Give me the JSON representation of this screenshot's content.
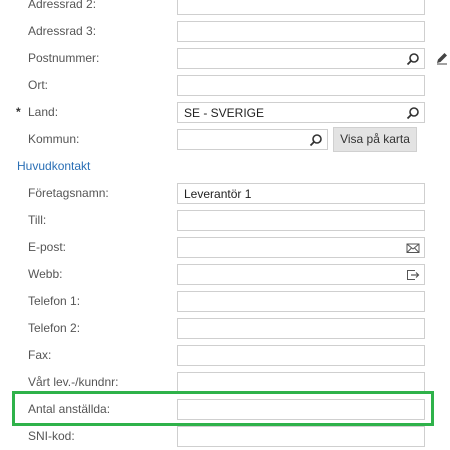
{
  "form": {
    "adressrad2": {
      "label": "Adressrad 2:",
      "value": ""
    },
    "adressrad3": {
      "label": "Adressrad 3:",
      "value": ""
    },
    "postnummer": {
      "label": "Postnummer:",
      "value": "",
      "icon": "search-icon"
    },
    "ort": {
      "label": "Ort:",
      "value": ""
    },
    "land": {
      "required_mark": "*",
      "label": "Land:",
      "value": "SE - SVERIGE",
      "icon": "search-icon"
    },
    "kommun": {
      "label": "Kommun:",
      "value": "",
      "icon": "search-icon",
      "button_label": "Visa på karta"
    },
    "section_title": "Huvudkontakt",
    "foretagsnamn": {
      "label": "Företagsnamn:",
      "value": "Leverantör 1"
    },
    "till": {
      "label": "Till:",
      "value": ""
    },
    "epost": {
      "label": "E-post:",
      "value": "",
      "icon": "envelope-icon"
    },
    "webb": {
      "label": "Webb:",
      "value": "",
      "icon": "open-link-icon"
    },
    "telefon1": {
      "label": "Telefon 1:",
      "value": ""
    },
    "telefon2": {
      "label": "Telefon 2:",
      "value": ""
    },
    "fax": {
      "label": "Fax:",
      "value": ""
    },
    "vart_lev_kundnr": {
      "label": "Vårt lev.-/kundnr:",
      "value": ""
    },
    "antal_anstallda": {
      "label": "Antal anställda:",
      "value": ""
    },
    "sni_kod": {
      "label": "SNI-kod:",
      "value": ""
    }
  },
  "colors": {
    "highlight": "#2fb24a",
    "section_title": "#2a6fb5",
    "field_border": "#cfcfcf"
  }
}
